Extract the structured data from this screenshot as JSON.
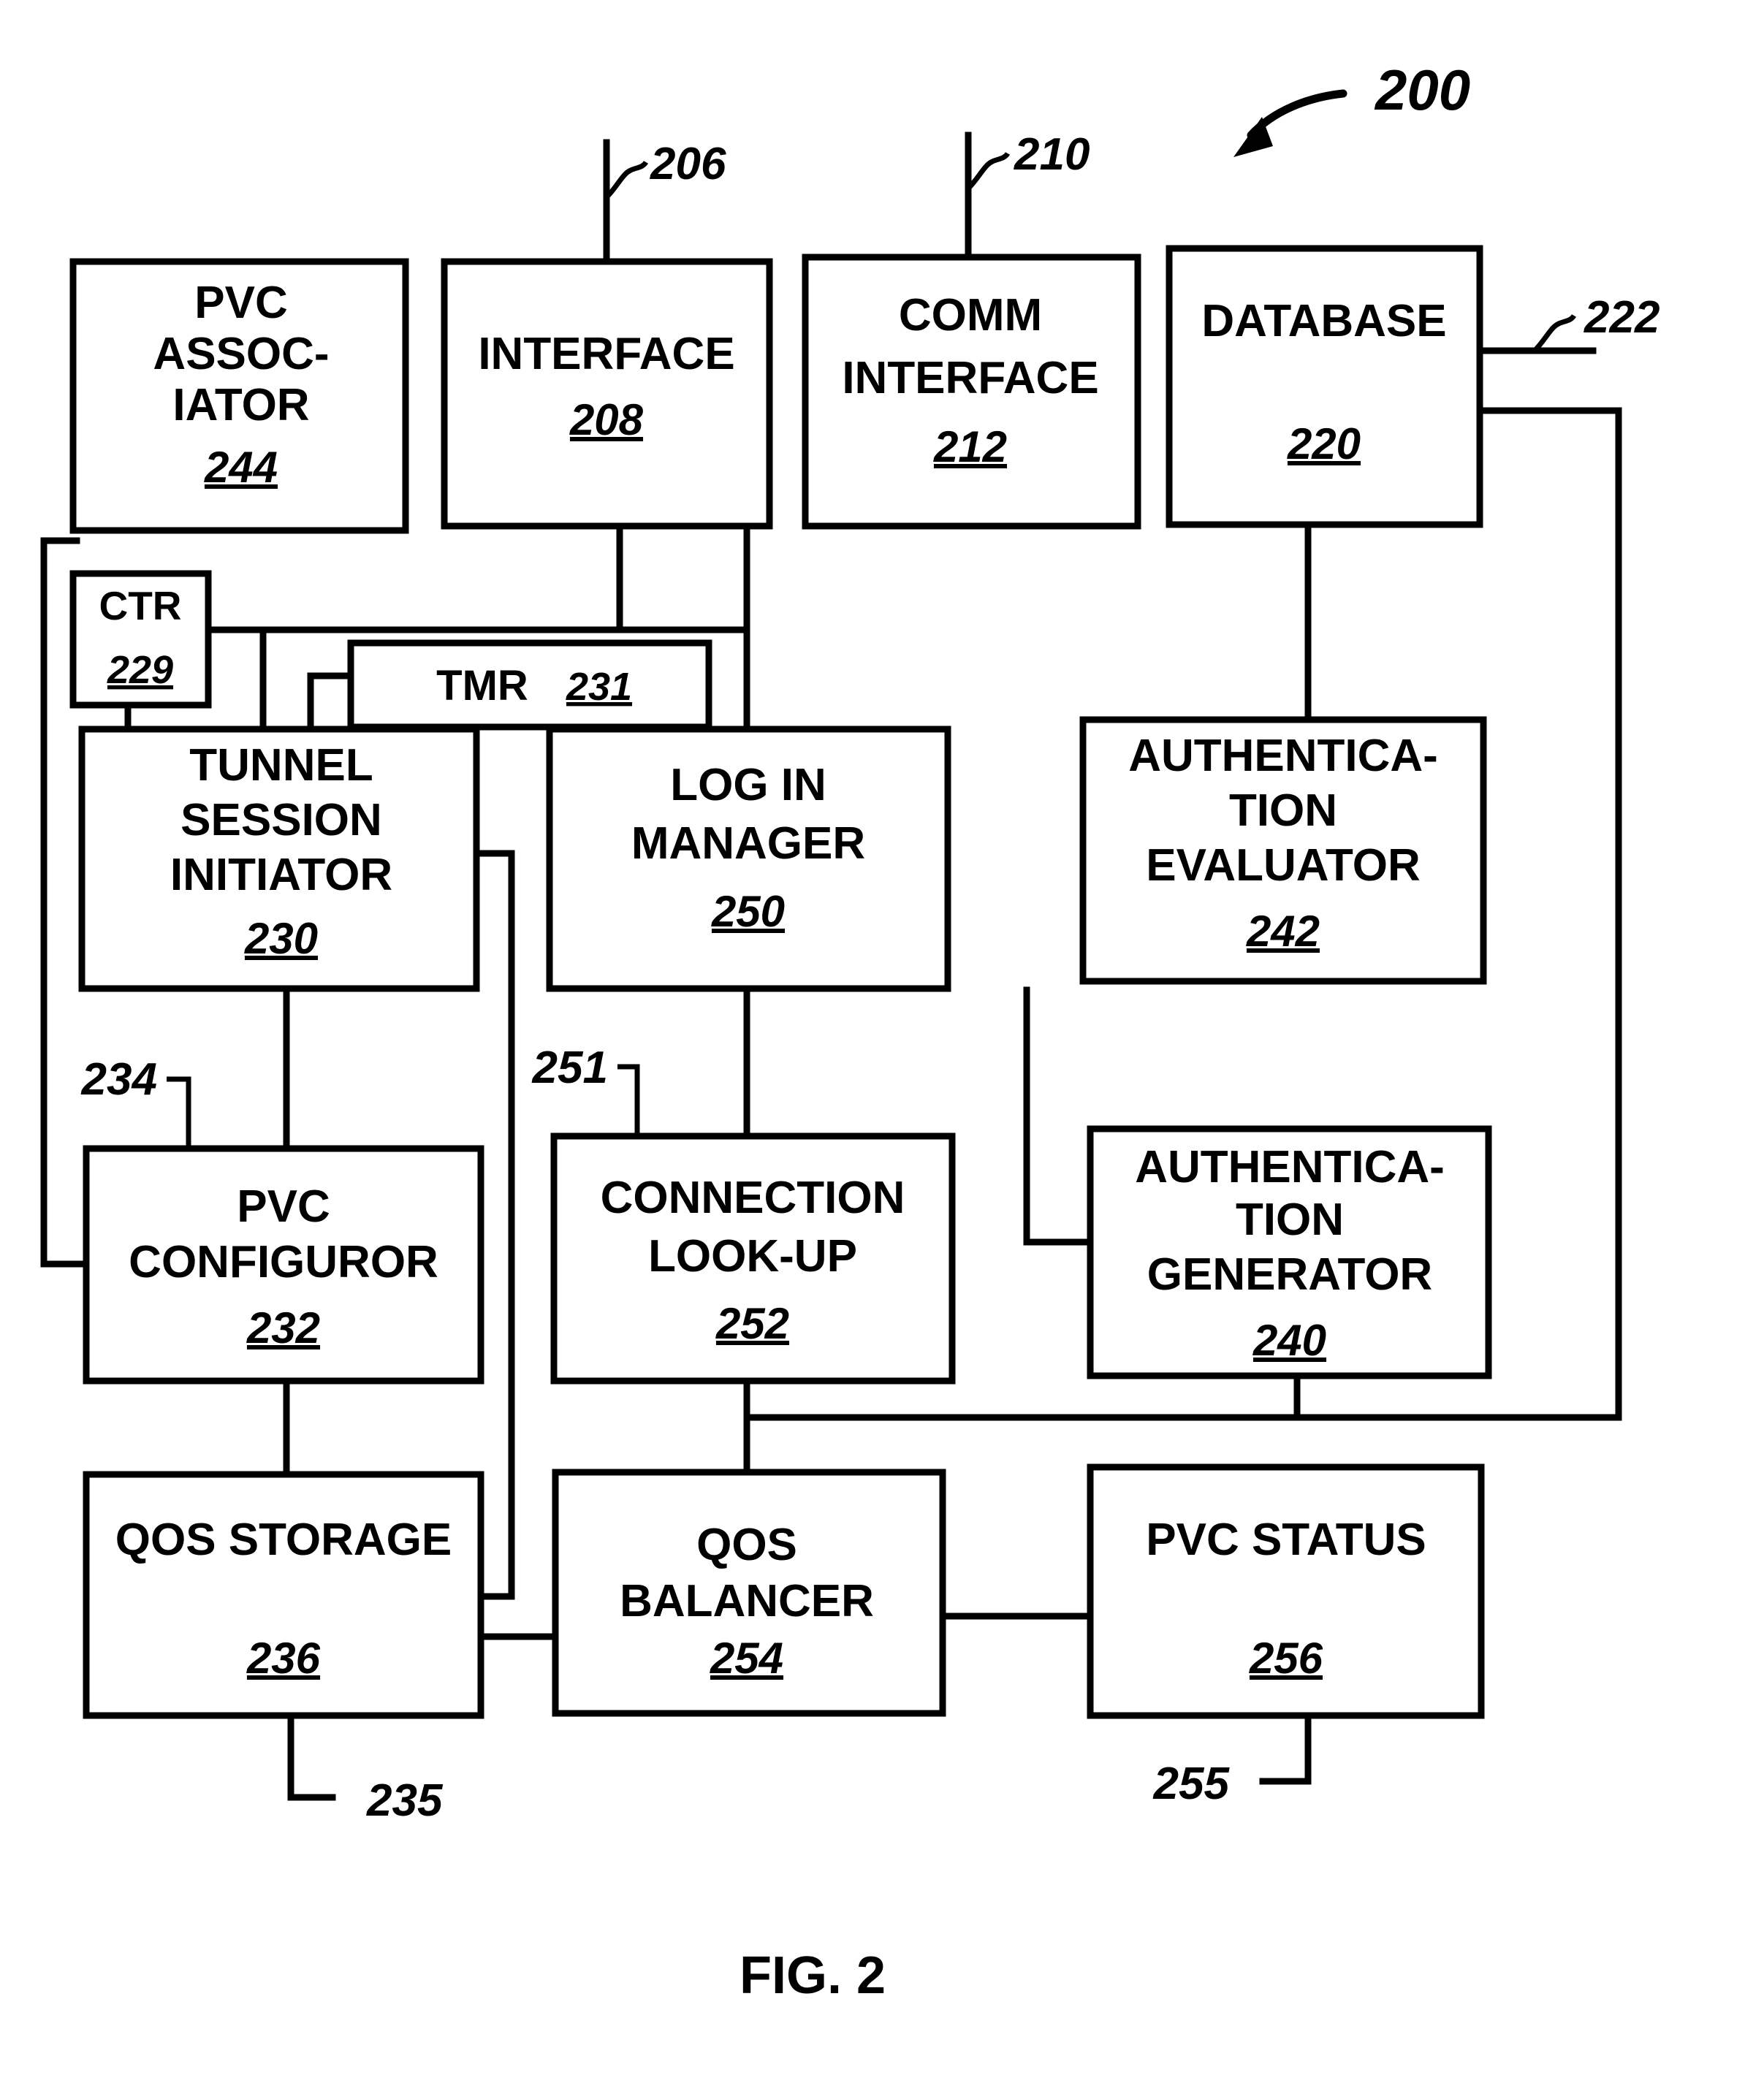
{
  "figure": {
    "caption": "FIG. 2",
    "system_label": "200"
  },
  "boxes": [
    {
      "id": "pvc_associator",
      "title_lines": [
        "PVC",
        "ASSOC-",
        "IATOR"
      ],
      "number": "244"
    },
    {
      "id": "interface",
      "title_lines": [
        "INTERFACE"
      ],
      "number": "208"
    },
    {
      "id": "comm_interface",
      "title_lines": [
        "COMM",
        "INTERFACE"
      ],
      "number": "212"
    },
    {
      "id": "database",
      "title_lines": [
        "DATABASE"
      ],
      "number": "220"
    },
    {
      "id": "ctr",
      "title_lines": [
        "CTR"
      ],
      "number": "229"
    },
    {
      "id": "tmr",
      "title_lines": [
        "TMR"
      ],
      "number": "231"
    },
    {
      "id": "tunnel_session_initiator",
      "title_lines": [
        "TUNNEL",
        "SESSION",
        "INITIATOR"
      ],
      "number": "230"
    },
    {
      "id": "login_manager",
      "title_lines": [
        "LOG IN",
        "MANAGER"
      ],
      "number": "250"
    },
    {
      "id": "authentication_evaluator",
      "title_lines": [
        "AUTHENTICA-",
        "TION",
        "EVALUATOR"
      ],
      "number": "242"
    },
    {
      "id": "pvc_configuror",
      "title_lines": [
        "PVC",
        "CONFIGUROR"
      ],
      "number": "232"
    },
    {
      "id": "connection_lookup",
      "title_lines": [
        "CONNECTION",
        "LOOK-UP"
      ],
      "number": "252"
    },
    {
      "id": "authentication_generator",
      "title_lines": [
        "AUTHENTICA-",
        "TION",
        "GENERATOR"
      ],
      "number": "240"
    },
    {
      "id": "qos_storage",
      "title_lines": [
        "QOS STORAGE"
      ],
      "number": "236"
    },
    {
      "id": "qos_balancer",
      "title_lines": [
        "QOS",
        "BALANCER"
      ],
      "number": "254"
    },
    {
      "id": "pvc_status",
      "title_lines": [
        "PVC STATUS"
      ],
      "number": "256"
    }
  ],
  "reference_numerals": {
    "n206": "206",
    "n210": "210",
    "n222": "222",
    "n234": "234",
    "n251": "251",
    "n235": "235",
    "n255": "255"
  },
  "colors": {
    "ink": "#000000",
    "paper": "#ffffff"
  }
}
